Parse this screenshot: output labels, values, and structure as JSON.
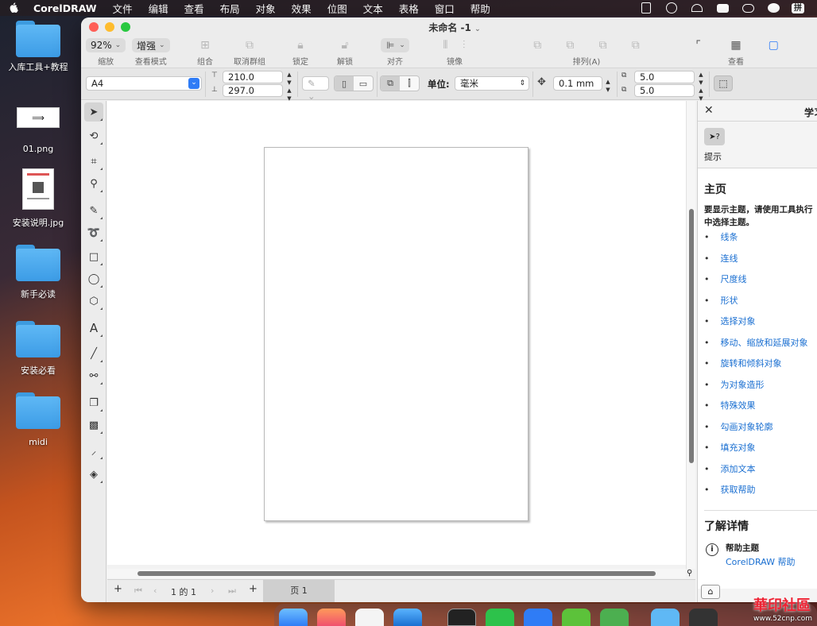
{
  "menubar": {
    "app_name": "CorelDRAW",
    "items": [
      "文件",
      "编辑",
      "查看",
      "布局",
      "对象",
      "效果",
      "位图",
      "文本",
      "表格",
      "窗口",
      "帮助"
    ],
    "input_method": "拼"
  },
  "desktop": {
    "icons": [
      {
        "label": "入库工具+教程",
        "type": "folder"
      },
      {
        "label": "01.png",
        "type": "image"
      },
      {
        "label": "安装说明.jpg",
        "type": "image"
      },
      {
        "label": "新手必读",
        "type": "folder"
      },
      {
        "label": "安装必看",
        "type": "folder"
      },
      {
        "label": "midi",
        "type": "folder"
      }
    ]
  },
  "window": {
    "title": "未命名 -1",
    "toolbar": {
      "zoom_value": "92%",
      "zoom_label": "缩放",
      "view_mode_value": "增强",
      "view_mode_label": "查看模式",
      "group_label": "组合",
      "ungroup_label": "取消群组",
      "lock_label": "锁定",
      "unlock_label": "解锁",
      "align_label": "对齐",
      "mirror_label": "镜像",
      "arrange_label": "排列(A)",
      "view_label": "查看"
    },
    "property_bar": {
      "page_size": "A4",
      "width": "210.0",
      "height": "297.0",
      "units_label": "单位:",
      "units_value": "毫米",
      "nudge": "0.1 mm",
      "dup_x": "5.0",
      "dup_y": "5.0"
    },
    "tools": [
      "pick-tool",
      "shape-tool",
      "crop-tool",
      "zoom-tool",
      "freehand-tool",
      "artistic-media-tool",
      "rectangle-tool",
      "ellipse-tool",
      "polygon-tool",
      "text-tool",
      "parallel-dimension-tool",
      "connector-tool",
      "drop-shadow-tool",
      "transparency-tool",
      "color-eyedropper-tool",
      "interactive-fill-tool"
    ],
    "page_nav": {
      "position": "1 的 1",
      "page_tab": "页 1"
    },
    "learn_panel": {
      "title": "学习",
      "hints_label": "提示",
      "home_heading": "主页",
      "description_line1": "要显示主题，请使用工具执行",
      "description_line2": "中选择主题。",
      "topics": [
        "线条",
        "连线",
        "尺度线",
        "形状",
        "选择对象",
        "移动、缩放和延展对象",
        "旋转和倾斜对象",
        "为对象造形",
        "特殊效果",
        "勾画对象轮廓",
        "填充对象",
        "添加文本",
        "获取帮助"
      ],
      "learn_more_heading": "了解详情",
      "help_topics_title": "帮助主题",
      "help_topics_link": "CorelDRAW 帮助"
    }
  },
  "watermark": {
    "text": "華印社區",
    "url": "www.52cnp.com"
  },
  "colors": {
    "link": "#1a6fd1",
    "folder": "#4aa8ee",
    "traffic_close": "#ff5f57",
    "traffic_min": "#febc2e",
    "traffic_max": "#28c840",
    "selection_blue": "#2f7cf6"
  }
}
